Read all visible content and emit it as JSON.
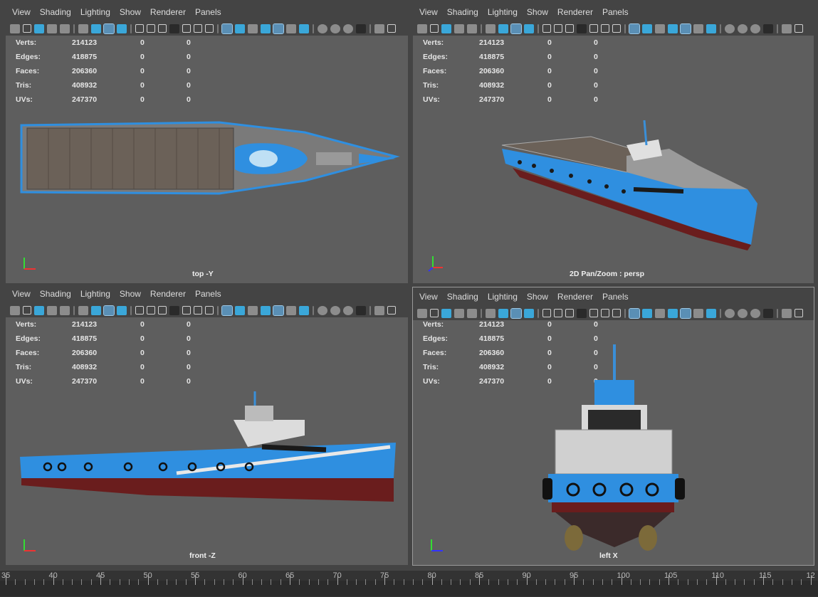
{
  "menu": [
    "View",
    "Shading",
    "Lighting",
    "Show",
    "Renderer",
    "Panels"
  ],
  "stats": [
    {
      "label": "Verts:",
      "v1": "214123",
      "v2": "0",
      "v3": "0"
    },
    {
      "label": "Edges:",
      "v1": "418875",
      "v2": "0",
      "v3": "0"
    },
    {
      "label": "Faces:",
      "v1": "206360",
      "v2": "0",
      "v3": "0"
    },
    {
      "label": "Tris:",
      "v1": "408932",
      "v2": "0",
      "v3": "0"
    },
    {
      "label": "UVs:",
      "v1": "247370",
      "v2": "0",
      "v3": "0"
    }
  ],
  "viewports": [
    {
      "id": "top",
      "camera": "top -Y"
    },
    {
      "id": "persp",
      "camera": "2D Pan/Zoom : persp"
    },
    {
      "id": "front",
      "camera": "front -Z"
    },
    {
      "id": "left",
      "camera": "left X"
    }
  ],
  "timeline": {
    "labels": [
      "35",
      "40",
      "45",
      "50",
      "55",
      "60",
      "65",
      "70",
      "75",
      "80",
      "85",
      "90",
      "95",
      "100",
      "105",
      "110",
      "115",
      "12"
    ]
  },
  "colors": {
    "hull_blue": "#2f8fe0",
    "hull_red": "#6a1d1d",
    "deck": "#6b6158",
    "viewport_bg": "#5e5e5e"
  }
}
